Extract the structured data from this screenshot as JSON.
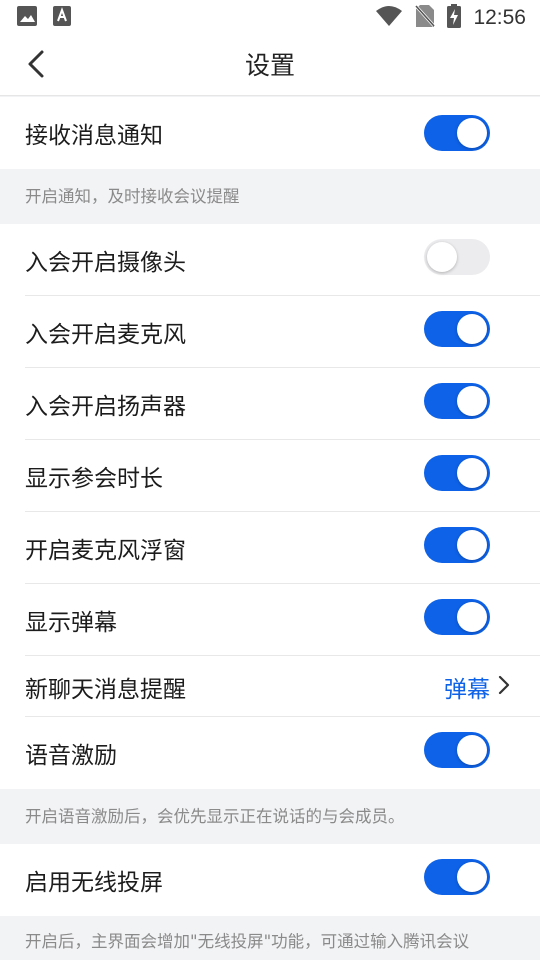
{
  "status_bar": {
    "time": "12:56",
    "icons": [
      "image-icon",
      "font-icon",
      "wifi-icon",
      "no-sim-icon",
      "battery-charging-icon"
    ]
  },
  "nav": {
    "title": "设置",
    "back_icon": "chevron-left-icon"
  },
  "colors": {
    "accent": "#0e62e8",
    "toggle_off": "#ececee",
    "hint_text": "#8a8a8a",
    "page_bg": "#f2f3f5"
  },
  "settings": {
    "receive_notify": {
      "label": "接收消息通知",
      "enabled": true
    },
    "receive_notify_hint": "开启通知，及时接收会议提醒",
    "camera_on_join": {
      "label": "入会开启摄像头",
      "enabled": false
    },
    "mic_on_join": {
      "label": "入会开启麦克风",
      "enabled": true
    },
    "speaker_on_join": {
      "label": "入会开启扬声器",
      "enabled": true
    },
    "show_duration": {
      "label": "显示参会时长",
      "enabled": true
    },
    "mic_float": {
      "label": "开启麦克风浮窗",
      "enabled": true
    },
    "show_barrage": {
      "label": "显示弹幕",
      "enabled": true
    },
    "new_chat_alert": {
      "label": "新聊天消息提醒",
      "value": "弹幕"
    },
    "voice_incentive": {
      "label": "语音激励",
      "enabled": true
    },
    "voice_incentive_hint": "开启语音激励后，会优先显示正在说话的与会成员。",
    "wireless_cast": {
      "label": "启用无线投屏",
      "enabled": true
    },
    "wireless_cast_hint": "开启后，主界面会增加\"无线投屏\"功能，可通过输入腾讯会议Rooms上的投屏码，向Rooms发起投屏。"
  }
}
